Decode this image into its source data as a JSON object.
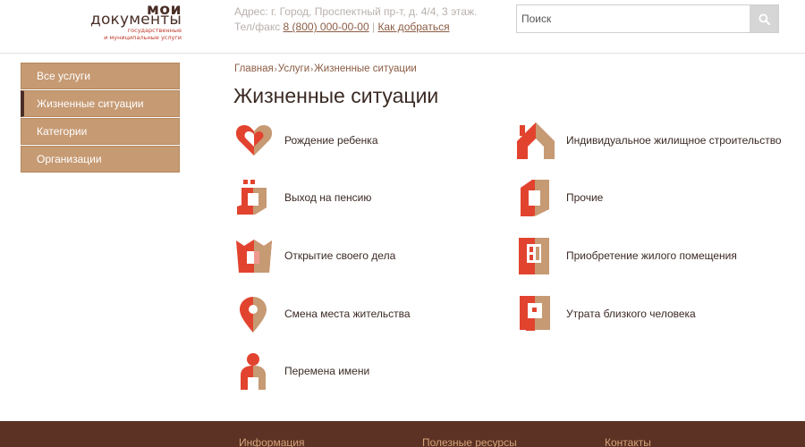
{
  "header": {
    "logo_top": "мои",
    "logo_main": "документы",
    "logo_sub_line1": "государственные",
    "logo_sub_line2": "и муниципальные услуги",
    "address": "Адрес: г. Город, Проспектный пр-т, д. 4/4, 3 этаж.",
    "phone_label": "Тел/факс",
    "phone": "8 (800) 000-00-00",
    "separator": "|",
    "directions_link": "Как добраться"
  },
  "search": {
    "placeholder": "Поиск"
  },
  "sidebar": {
    "items": [
      {
        "label": "Все услуги"
      },
      {
        "label": "Жизненные ситуации"
      },
      {
        "label": "Категории"
      },
      {
        "label": "Организации"
      }
    ]
  },
  "breadcrumb": {
    "items": [
      "Главная",
      "Услуги",
      "Жизненные ситуации"
    ],
    "separator": "›"
  },
  "page_title": "Жизненные ситуации",
  "situations": {
    "left": [
      {
        "label": "Рождение ребенка",
        "icon": "heart-icon"
      },
      {
        "label": "Выход на пенсию",
        "icon": "retirement-icon"
      },
      {
        "label": "Открытие своего дела",
        "icon": "business-icon"
      },
      {
        "label": "Смена места жительства",
        "icon": "location-pin-icon"
      },
      {
        "label": "Перемена имени",
        "icon": "person-icon"
      }
    ],
    "right": [
      {
        "label": "Индивидуальное жилищное строительство",
        "icon": "house-icon"
      },
      {
        "label": "Прочие",
        "icon": "document-icon"
      },
      {
        "label": "Приобретение жилого помещения",
        "icon": "apartment-icon"
      },
      {
        "label": "Утрата близкого человека",
        "icon": "frame-icon"
      }
    ]
  },
  "footer": {
    "links": [
      "Информация",
      "Полезные ресурсы",
      "Контакты"
    ]
  },
  "colors": {
    "accent_red": "#e2432f",
    "accent_tan": "#c69a73",
    "brand_brown": "#5b3223"
  }
}
